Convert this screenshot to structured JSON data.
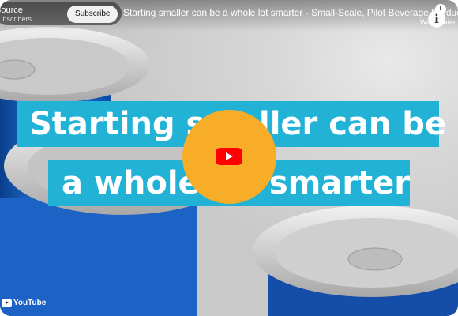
{
  "channel": {
    "name": "Source",
    "subscribers": "subscribers",
    "subscribe_label": "Subscribe"
  },
  "video": {
    "title": "Starting smaller can be a whole lot smarter - Small-Scale, Pilot Beverage Production"
  },
  "controls": {
    "watch_later_label": "Watch later",
    "info_label": "i"
  },
  "overlay": {
    "line1": "Starting smaller can be",
    "line2": "a whole lot smarter"
  },
  "branding": {
    "logo_text": "YouTube"
  },
  "colors": {
    "caption_bg": "#22b2d6",
    "play_button": "#f7ad27",
    "youtube_red": "#ff0000",
    "can_blue": "#1f6fd0"
  }
}
